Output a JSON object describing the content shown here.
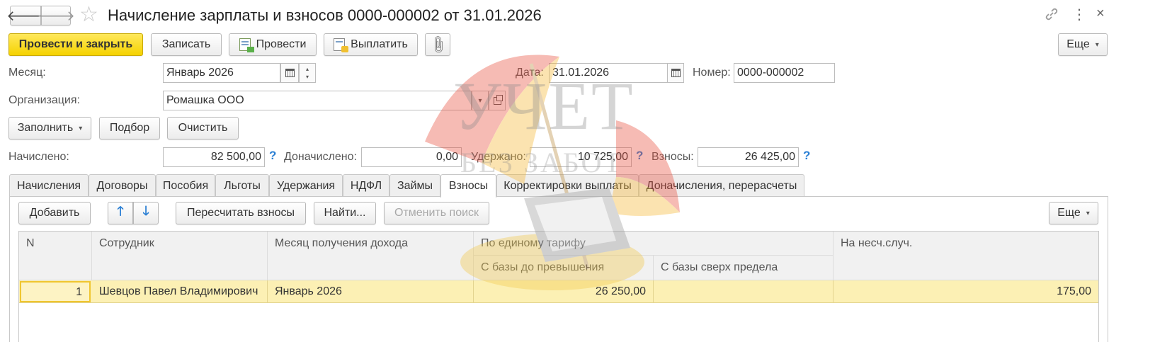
{
  "window": {
    "title": "Начисление зарплаты и взносов 0000-000002 от 31.01.2026"
  },
  "toolbar": {
    "post_close": "Провести и закрыть",
    "save": "Записать",
    "post": "Провести",
    "pay": "Выплатить",
    "more": "Еще"
  },
  "form": {
    "month_label": "Месяц:",
    "month_value": "Январь 2026",
    "date_label": "Дата:",
    "date_value": "31.01.2026",
    "number_label": "Номер:",
    "number_value": "0000-000002",
    "org_label": "Организация:",
    "org_value": "Ромашка ООО"
  },
  "actions": {
    "fill": "Заполнить",
    "select": "Подбор",
    "clear": "Очистить"
  },
  "totals": {
    "accrued_label": "Начислено:",
    "accrued_value": "82 500,00",
    "additional_label": "Доначислено:",
    "additional_value": "0,00",
    "withheld_label": "Удержано:",
    "withheld_value": "10 725,00",
    "contributions_label": "Взносы:",
    "contributions_value": "26 425,00",
    "help": "?"
  },
  "tabs": [
    {
      "label": "Начисления"
    },
    {
      "label": "Договоры"
    },
    {
      "label": "Пособия"
    },
    {
      "label": "Льготы"
    },
    {
      "label": "Удержания"
    },
    {
      "label": "НДФЛ"
    },
    {
      "label": "Займы"
    },
    {
      "label": "Взносы"
    },
    {
      "label": "Корректировки выплаты"
    },
    {
      "label": "Доначисления, перерасчеты"
    }
  ],
  "active_tab_index": 7,
  "table_toolbar": {
    "add": "Добавить",
    "recalc": "Пересчитать взносы",
    "find": "Найти...",
    "cancel_search": "Отменить поиск",
    "more": "Еще"
  },
  "table": {
    "headers": {
      "n": "N",
      "employee": "Сотрудник",
      "income_month": "Месяц получения дохода",
      "single_rate": "По единому тарифу",
      "below_limit": "С базы до превышения",
      "above_limit": "С базы сверх предела",
      "accident": "На несч.случ."
    },
    "rows": [
      {
        "n": "1",
        "employee": "Шевцов Павел Владимирович",
        "income_month": "Январь 2026",
        "below_limit": "26 250,00",
        "above_limit": "",
        "accident": "175,00"
      }
    ]
  },
  "watermark": {
    "line1": "УЧЕТ",
    "line2": "БЕЗ ЗАБОТ"
  },
  "colors": {
    "primary_button": "#f5d200",
    "selected_row": "#fcf0b4",
    "help_icon": "#2a7fd4"
  }
}
